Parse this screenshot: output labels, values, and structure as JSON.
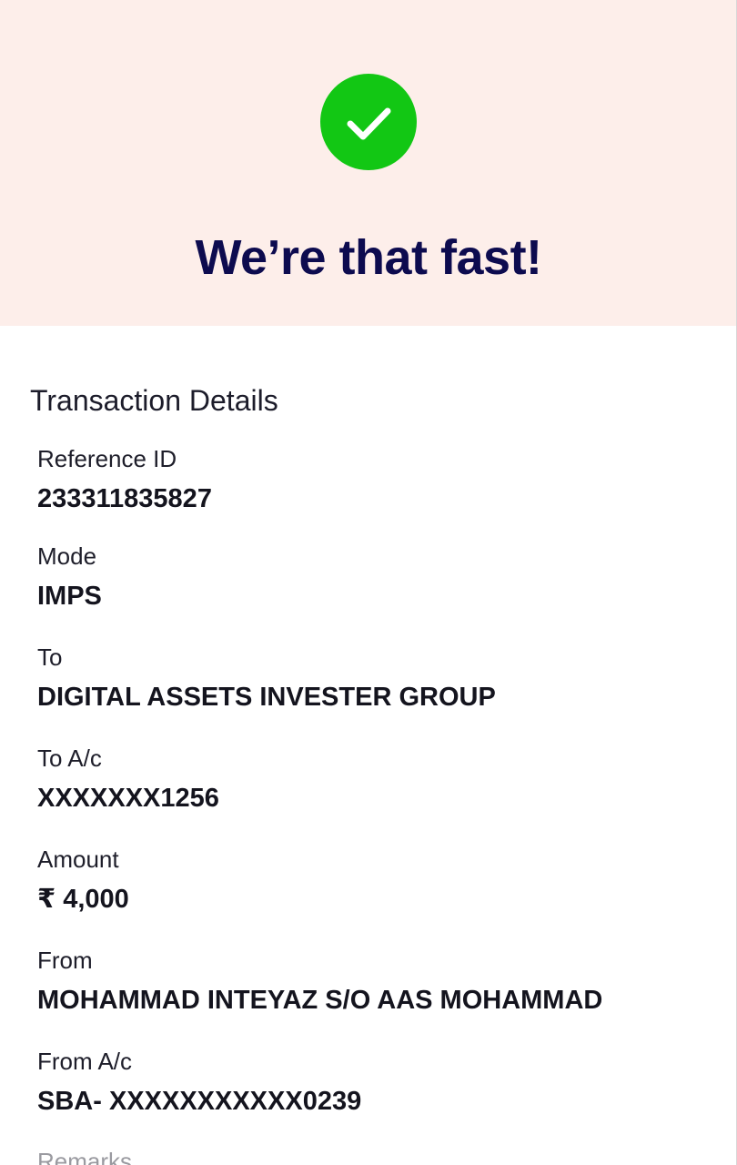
{
  "success": {
    "icon": "check-icon",
    "color": "#12c714",
    "title": "We’re that fast!"
  },
  "details": {
    "section_title": "Transaction Details",
    "fields": [
      {
        "label": "Reference ID",
        "value": "233311835827"
      },
      {
        "label": "Mode",
        "value": "IMPS"
      },
      {
        "label": "To",
        "value": "DIGITAL ASSETS INVESTER GROUP"
      },
      {
        "label": "To A/c",
        "value": "XXXXXXX1256"
      },
      {
        "label": "Amount",
        "value": "₹ 4,000"
      },
      {
        "label": "From",
        "value": "MOHAMMAD INTEYAZ S/O AAS MOHAMMAD"
      },
      {
        "label": "From A/c",
        "value": "SBA- XXXXXXXXXXX0239"
      },
      {
        "label": "Remarks"
      }
    ]
  }
}
